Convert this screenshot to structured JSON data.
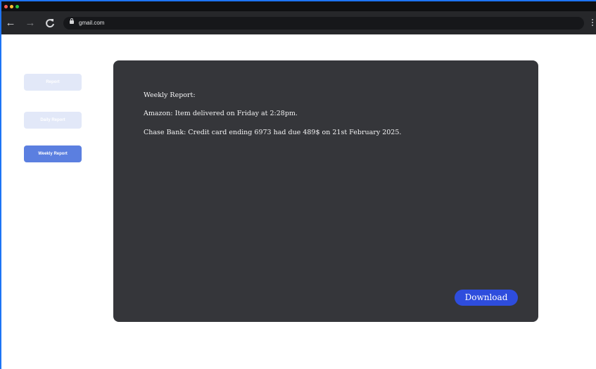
{
  "browser": {
    "url": "gmail.com",
    "icons": [
      "back-arrow-icon",
      "forward-arrow-icon",
      "reload-icon",
      "lock-icon",
      "menu-icon"
    ]
  },
  "sidebar": {
    "buttons": [
      {
        "label": "Report"
      },
      {
        "label": "Daily Report"
      },
      {
        "label": "Weekly Report"
      }
    ]
  },
  "panel": {
    "heading": "Weekly Report:",
    "lines": [
      "Amazon: Item delivered on Friday at 2:28pm.",
      "Chase Bank: Credit card ending 6973 had due 489$ on 21st February 2025."
    ],
    "download_label": "Download"
  },
  "colors": {
    "accent": "#2e4ddd",
    "active_nav": "#5b7fe0",
    "panel_bg": "#35363a"
  }
}
